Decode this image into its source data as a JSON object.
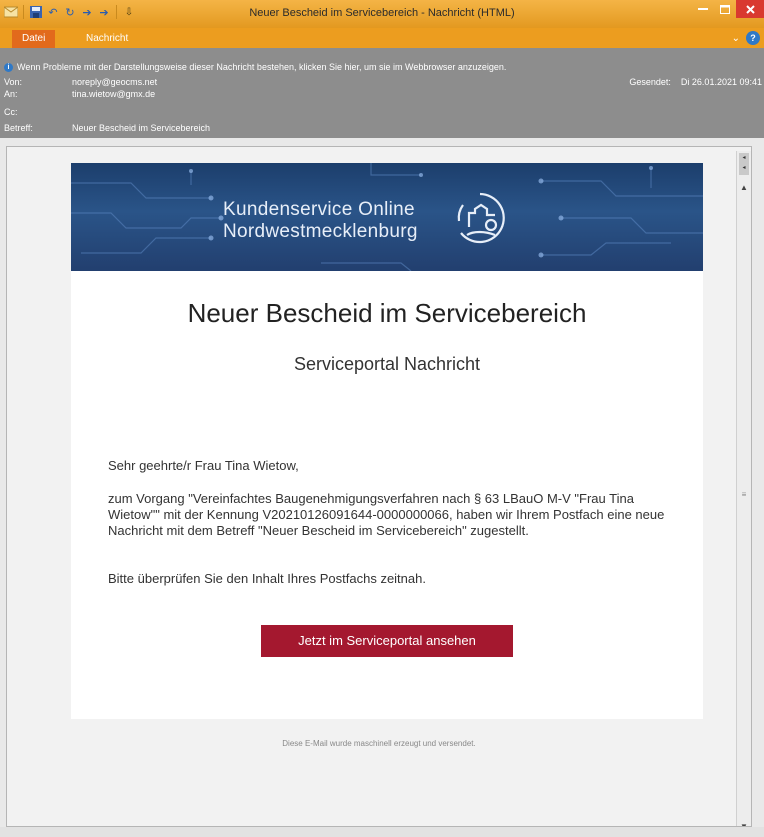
{
  "window": {
    "title": "Neuer Bescheid im Servicebereich - Nachricht (HTML)",
    "accent": "#e8a030",
    "close_color": "#d9392f"
  },
  "ribbon": {
    "tabs": [
      {
        "label": "Datei"
      },
      {
        "label": "Nachricht"
      }
    ]
  },
  "header": {
    "infobar": "Wenn Probleme mit der Darstellungsweise dieser Nachricht bestehen, klicken Sie hier, um sie im Webbrowser anzuzeigen.",
    "from_label": "Von:",
    "from_value": "noreply@geocms.net",
    "to_label": "An:",
    "to_value": "tina.wietow@gmx.de",
    "cc_label": "Cc:",
    "cc_value": "",
    "subject_label": "Betreff:",
    "subject_value": "Neuer Bescheid im Servicebereich",
    "sent_label": "Gesendet:",
    "sent_value": "Di 26.01.2021 09:41"
  },
  "email": {
    "banner_line1": "Kundenservice Online",
    "banner_line2": "Nordwestmecklenburg",
    "heading": "Neuer Bescheid im Servicebereich",
    "subheading": "Serviceportal Nachricht",
    "greeting": "Sehr geehrte/r Frau Tina Wietow,",
    "body1": "zum Vorgang \"Vereinfachtes Baugenehmigungsverfahren nach § 63 LBauO M-V \"Frau Tina Wietow\"\" mit der Kennung V20210126091644-0000000066, haben wir Ihrem Postfach eine neue Nachricht mit dem Betreff \"Neuer Bescheid im Servicebereich\" zugestellt.",
    "body2": "Bitte überprüfen Sie den Inhalt Ihres Postfachs zeitnah.",
    "cta_label": "Jetzt im Serviceportal ansehen",
    "cta_color": "#a4182f",
    "footer": "Diese E-Mail wurde maschinell erzeugt und versendet."
  },
  "icons": {
    "app": "outlook-icon",
    "save": "save-icon",
    "undo": "undo-icon",
    "redo": "redo-icon",
    "prev": "up-arrow-icon",
    "next": "down-arrow-icon",
    "customize": "customize-icon",
    "info": "info-icon",
    "logo": "castle-logo-icon"
  }
}
